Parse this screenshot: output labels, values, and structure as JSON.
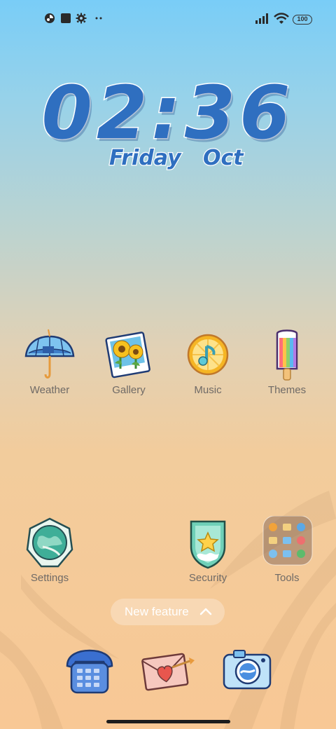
{
  "status_bar": {
    "left_icons": [
      "pie-chart-icon",
      "square-app-icon",
      "gear-icon",
      "more-dots-icon"
    ],
    "right_icons": [
      "signal-bars-icon",
      "wifi-icon",
      "battery-icon"
    ],
    "battery_level": "100"
  },
  "clock": {
    "time": "02:36",
    "day": "Friday",
    "month": "Oct"
  },
  "apps_row1": [
    {
      "label": "Weather",
      "icon": "umbrella-icon"
    },
    {
      "label": "Gallery",
      "icon": "sunflower-photo-icon"
    },
    {
      "label": "Music",
      "icon": "lemon-music-note-icon"
    },
    {
      "label": "Themes",
      "icon": "popsicle-icon"
    }
  ],
  "apps_row2": [
    {
      "label": "Settings",
      "icon": "globe-badge-icon"
    },
    {
      "label": "Security",
      "icon": "shield-star-icon"
    },
    {
      "label": "Tools",
      "icon": "folder-icon"
    }
  ],
  "new_feature": {
    "label": "New feature",
    "icon": "chevron-up-icon"
  },
  "dock": [
    {
      "icon": "phone-icon"
    },
    {
      "icon": "envelope-heart-icon"
    },
    {
      "icon": "camera-icon"
    }
  ],
  "colors": {
    "clock_blue": "#2f6fc0",
    "label_gray": "#6f6a66"
  }
}
